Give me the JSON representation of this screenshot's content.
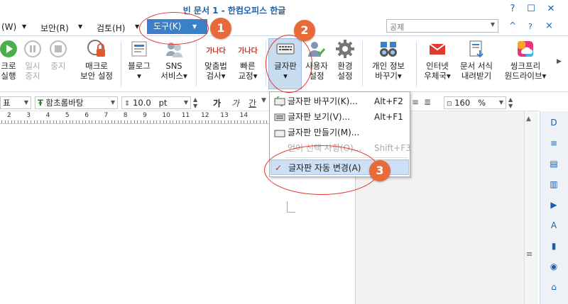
{
  "title": "빈 문서 1 - 한컴오피스 한글",
  "window_controls": {
    "help": "?",
    "minimize": "—",
    "maximize": "☐",
    "close": "✕"
  },
  "menus": [
    "(W)",
    "보안(R)",
    "검토(H)"
  ],
  "tools_menu_label": "도구(K)",
  "search": {
    "value": "공제"
  },
  "ribbon_topright": {
    "collapse": "^",
    "help": "?",
    "close": "×"
  },
  "ribbon": {
    "macro_run": "크로\n실행",
    "macro_pause": "일시\n중지",
    "macro_stop": "중지",
    "macro_security": "매크로\n보안 설정",
    "blog": "블로그\n▾",
    "sns": "SNS\n서비스▾",
    "spellcheck": "맞춤법\n검사▾",
    "quick_correct": "빠른\n교정▾",
    "keyboard": "글자판\n▾",
    "user_settings": "사용자\n설정",
    "env_settings": "환경\n설정",
    "personal_info": "개인 정보\n바꾸기▾",
    "internet_post": "인터넷\n우체국▾",
    "doc_format_download": "문서 서식\n내려받기",
    "thinkfree_drive": "씽크프리\n원드라이브▾"
  },
  "icon_text": {
    "gana": "가나다"
  },
  "format": {
    "style": "표",
    "font": "함초롬바탕",
    "font_icon": "Ŧ",
    "size": "10.0",
    "size_unit": "pt",
    "bold": "가",
    "italic": "가",
    "underline": "간",
    "zoom": "160",
    "zoom_unit": "%"
  },
  "ruler_numbers": [
    "2",
    "3",
    "4",
    "5",
    "6",
    "7",
    "8",
    "9",
    "10",
    "11",
    "12",
    "13",
    "14"
  ],
  "dropdown": [
    {
      "label": "글자판 바꾸기(K)...",
      "key": "Alt+F2",
      "disabled": false
    },
    {
      "label": "글자판 보기(V)...",
      "key": "Alt+F1",
      "disabled": false
    },
    {
      "label": "글자판 만들기(M)...",
      "key": "",
      "disabled": false
    },
    {
      "label": "언어 선택 사항(O)...",
      "key": "Shift+F3",
      "disabled": true
    },
    {
      "label": "글자판 자동 변경(A)",
      "key": "",
      "checked": true,
      "checkmark": "✓"
    }
  ],
  "side_panel": [
    "D",
    "≡",
    "▤",
    "▥",
    "▶",
    "A",
    "▮",
    "◉",
    "⌂"
  ],
  "badges": [
    "1",
    "2",
    "3"
  ],
  "colors": {
    "accent": "#3a80c8",
    "annotation": "#e0392f",
    "badge": "#e86a3a"
  }
}
